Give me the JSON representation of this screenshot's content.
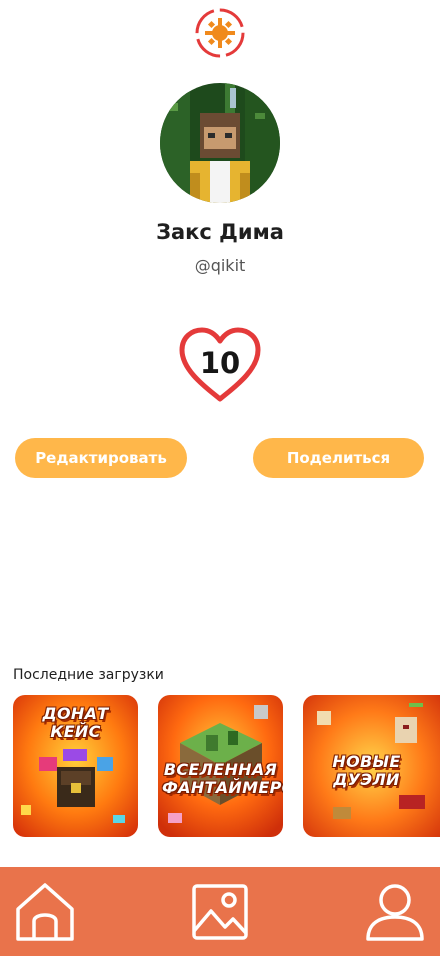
{
  "profile": {
    "name": "Закс Дима",
    "handle": "@qikit",
    "likes": "10"
  },
  "actions": {
    "edit_label": "Редактировать",
    "share_label": "Поделиться"
  },
  "recent": {
    "title": "Последние загрузки",
    "items": [
      {
        "title": "ДОНАТ КЕЙС"
      },
      {
        "title": "ВСЕЛЕННАЯ ФАНТАЙМЕРОВ"
      },
      {
        "title": "НОВЫЕ ДУЭЛИ"
      }
    ]
  },
  "nav": {
    "icons": [
      "home-icon",
      "gallery-icon",
      "profile-icon"
    ]
  },
  "colors": {
    "accent": "#ffb74a",
    "nav_bg": "#e9734b",
    "heart": "#e43a3a"
  }
}
